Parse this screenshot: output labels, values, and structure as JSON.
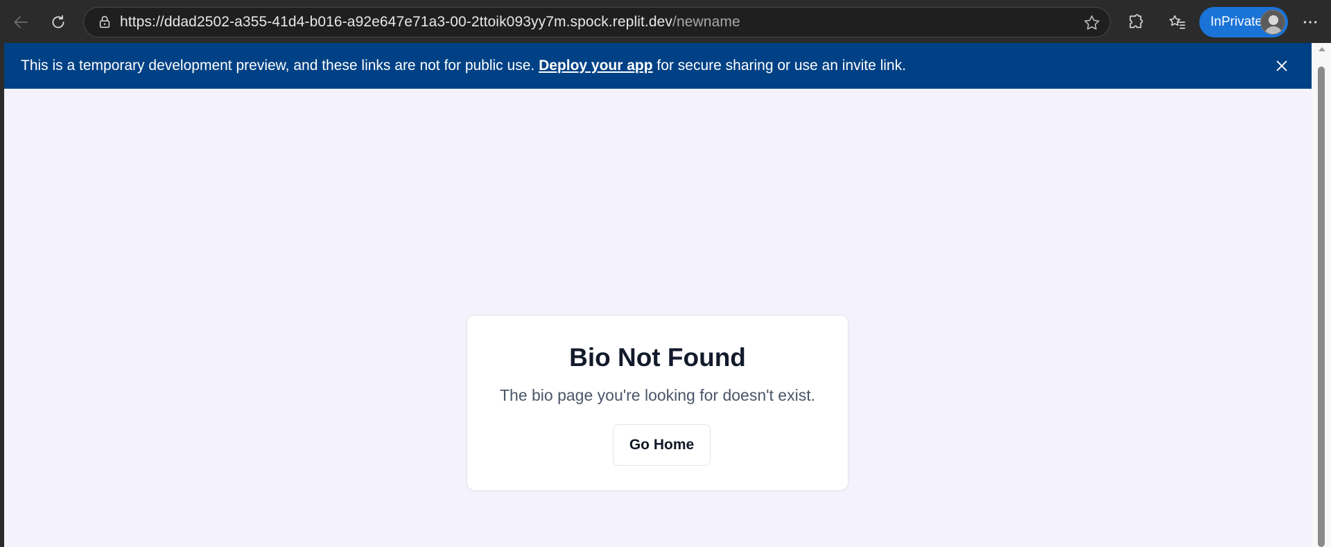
{
  "browser": {
    "url_host": "https://ddad2502-a355-41d4-b016-a92e647e71a3-00-2ttoik093yy7m.spock.replit.dev",
    "url_path": "/newname",
    "inprivate_label": "InPrivate",
    "icons": {
      "back": "back-arrow-icon",
      "refresh": "refresh-icon",
      "lock": "lock-icon",
      "favorite": "star-icon",
      "extensions": "puzzle-icon",
      "favorites": "favorites-icon",
      "more": "more-icon"
    },
    "accent_color": "#1a73d6"
  },
  "banner": {
    "text_before": "This is a temporary development preview, and these links are not for public use. ",
    "link_text": "Deploy your app",
    "text_after": " for secure sharing or use an invite link.",
    "background": "#004185"
  },
  "card": {
    "title": "Bio Not Found",
    "message": "The bio page you're looking for doesn't exist.",
    "button_label": "Go Home"
  }
}
